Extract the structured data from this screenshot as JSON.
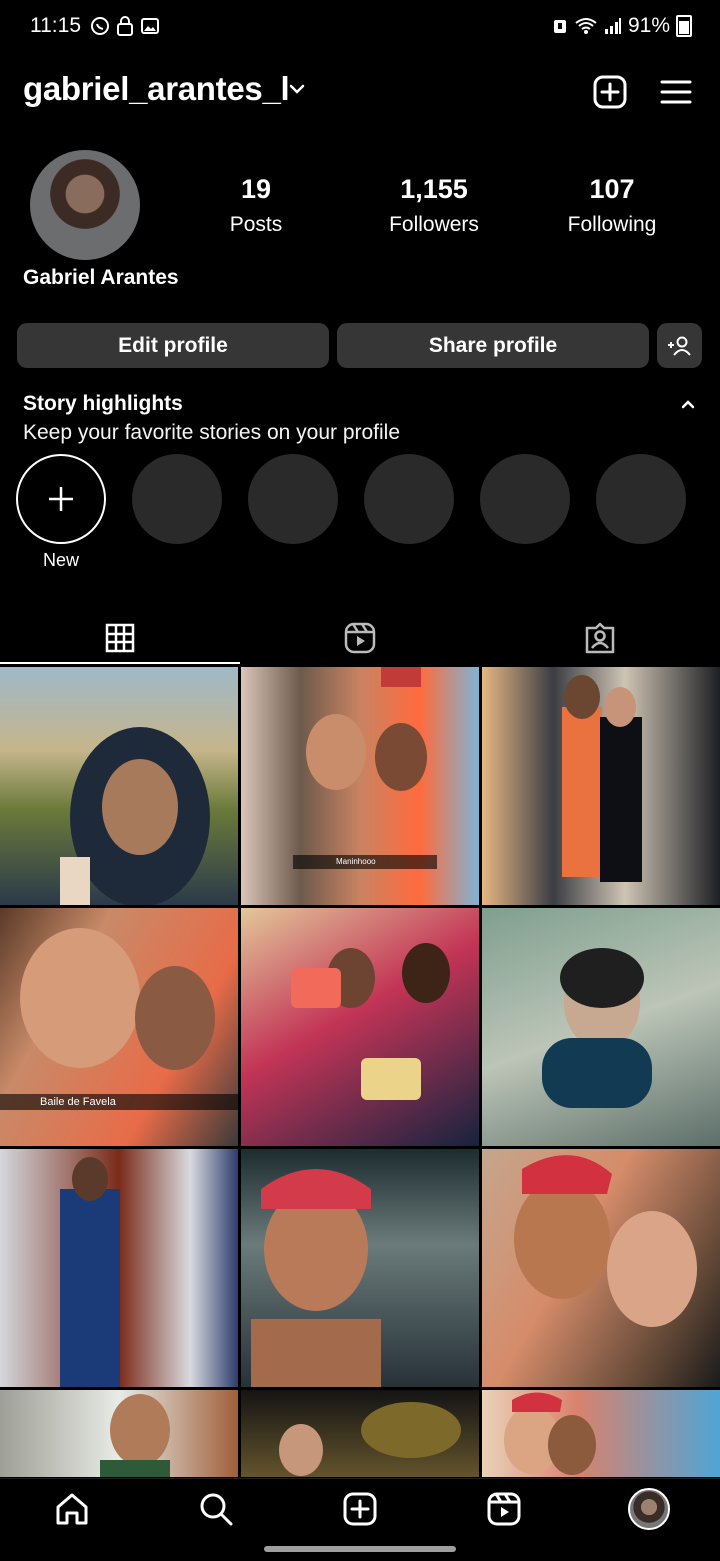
{
  "status_bar": {
    "time": "11:15",
    "battery": "91%"
  },
  "header": {
    "username": "gabriel_arantes_l"
  },
  "profile": {
    "full_name": "Gabriel Arantes",
    "stats": [
      {
        "value": "19",
        "label": "Posts"
      },
      {
        "value": "1,155",
        "label": "Followers"
      },
      {
        "value": "107",
        "label": "Following"
      }
    ],
    "buttons": {
      "edit": "Edit profile",
      "share": "Share profile"
    }
  },
  "highlights": {
    "title": "Story highlights",
    "subtitle": "Keep your favorite stories on your profile",
    "new_label": "New"
  },
  "tabs": [
    {
      "icon": "grid-icon",
      "active": true
    },
    {
      "icon": "reels-icon",
      "active": false
    },
    {
      "icon": "tagged-icon",
      "active": false
    }
  ],
  "grid": {
    "captions": [
      "Maninhooo",
      "Baile de Favela"
    ]
  },
  "bottom_nav": [
    {
      "icon": "home-icon"
    },
    {
      "icon": "search-icon"
    },
    {
      "icon": "create-icon"
    },
    {
      "icon": "reels-icon"
    },
    {
      "icon": "profile-avatar"
    }
  ]
}
